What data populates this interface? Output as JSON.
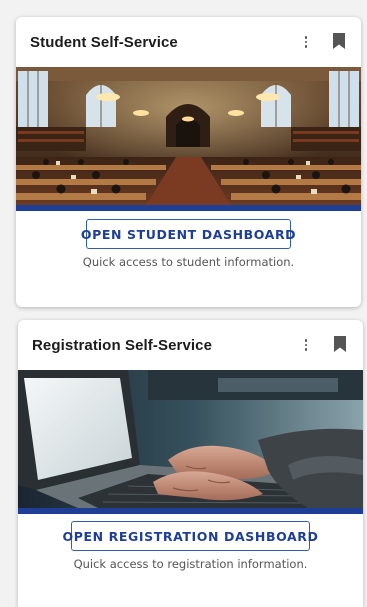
{
  "cards": [
    {
      "title": "Student Self-Service",
      "button_label": "OPEN STUDENT DASHBOARD",
      "description": "Quick access to student information.",
      "menu_icon": "more-vert-icon",
      "bookmark_icon": "bookmark-icon"
    },
    {
      "title": "Registration Self-Service",
      "button_label": "OPEN REGISTRATION DASHBOARD",
      "description": "Quick access to registration information.",
      "menu_icon": "more-vert-icon",
      "bookmark_icon": "bookmark-icon"
    }
  ],
  "colors": {
    "accent": "#1e3f95",
    "button_border": "#2f5fa8",
    "title_text": "#1c1c1c",
    "description_text": "#555555"
  }
}
